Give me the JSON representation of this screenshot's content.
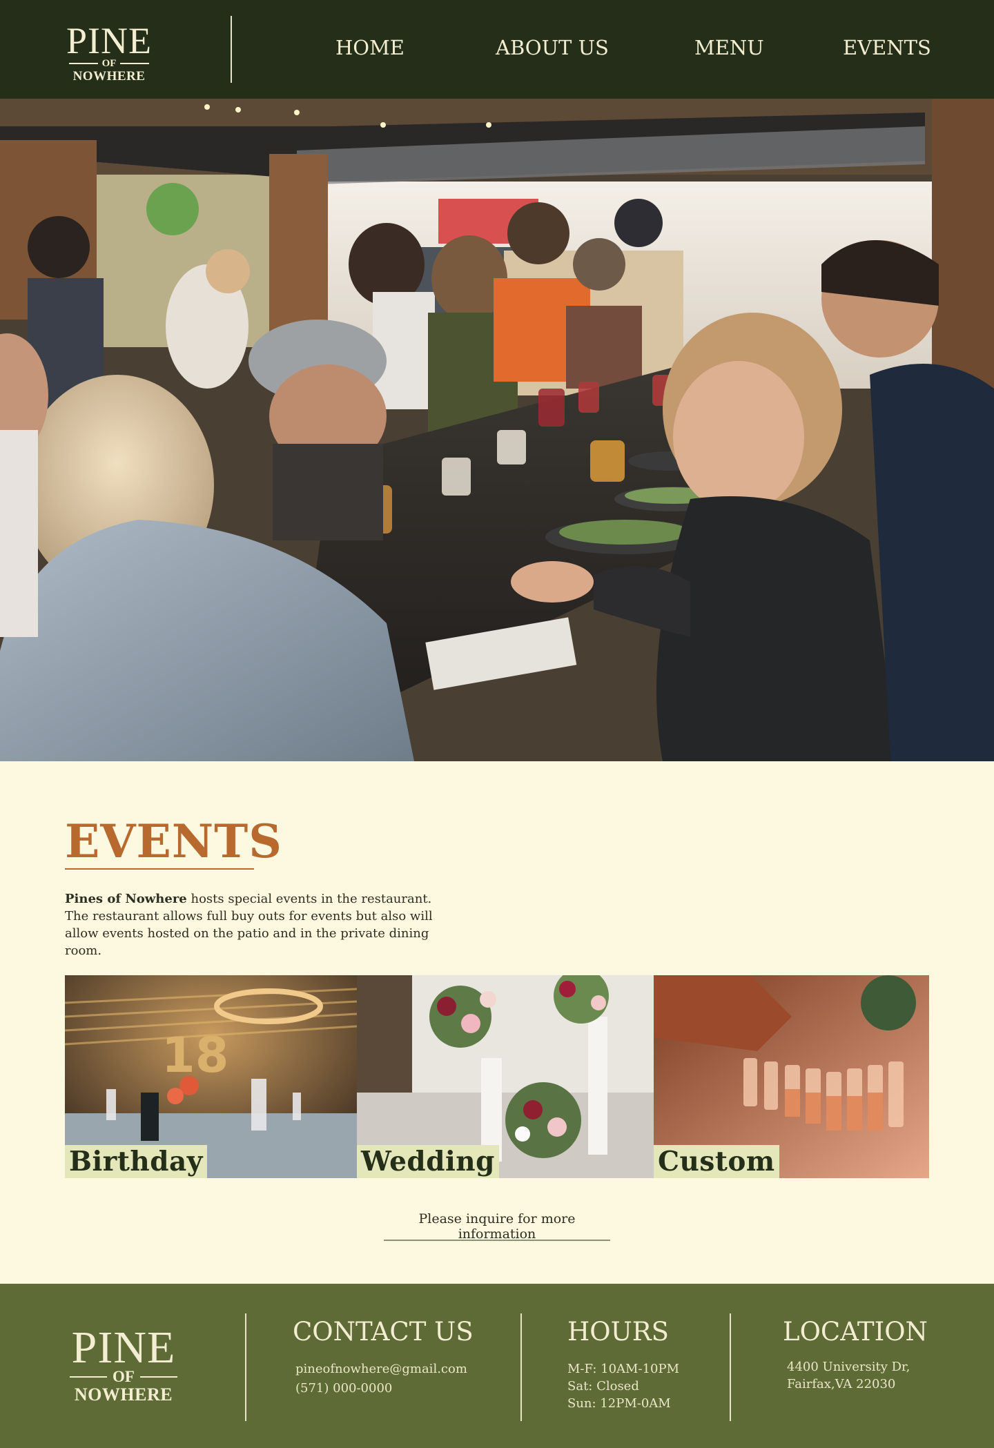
{
  "brand": {
    "big": "PINE",
    "of": "OF",
    "small": "NOWHERE"
  },
  "nav": {
    "home": "HOME",
    "about": "ABOUT US",
    "menu": "MENU",
    "events": "EVENTS"
  },
  "events": {
    "title": "EVENTS",
    "desc_bold": "Pines of Nowhere",
    "desc_rest": " hosts special events in the restaurant. The restaurant allows full buy outs for events but also will allow events hosted on the patio and in the private dining room.",
    "tiles": [
      {
        "label": "Birthday"
      },
      {
        "label": "Wedding"
      },
      {
        "label": "Custom"
      }
    ],
    "inquire": "Please inquire for more information"
  },
  "footer": {
    "contact_heading": "CONTACT US",
    "email": "pineofnowhere@gmail.com",
    "phone": "(571) 000-0000",
    "hours_heading": "HOURS",
    "hours": [
      "M-F: 10AM-10PM",
      "Sat: Closed",
      "Sun: 12PM-0AM"
    ],
    "location_heading": "LOCATION",
    "address_line1": "4400 University Dr,",
    "address_line2": "Fairfax,VA 22030"
  },
  "colors": {
    "header_bg": "#252e18",
    "page_bg": "#fdf8e0",
    "accent": "#b8692e",
    "footer_bg": "#5e6b36",
    "label_bg": "#e3e7b9"
  }
}
